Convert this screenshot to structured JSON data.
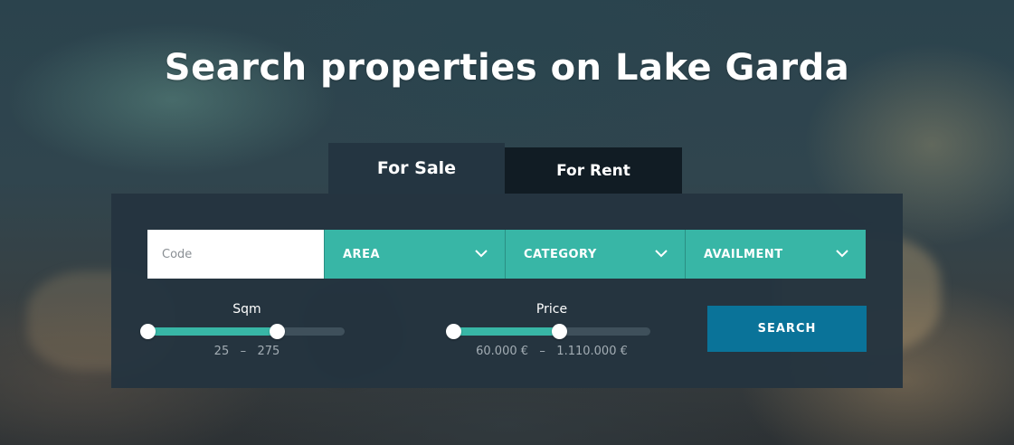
{
  "hero": {
    "title": "Search properties on Lake Garda"
  },
  "tabs": [
    {
      "label": "For Sale",
      "active": true
    },
    {
      "label": "For Rent",
      "active": false
    }
  ],
  "search_form": {
    "code_placeholder": "Code",
    "dropdowns": [
      {
        "label": "AREA"
      },
      {
        "label": "CATEGORY"
      },
      {
        "label": "AVAILMENT"
      }
    ],
    "sqm": {
      "label": "Sqm",
      "min": 25,
      "max": 275,
      "range_text": "25   –   275"
    },
    "price": {
      "label": "Price",
      "min_text": "60.000 €",
      "max_text": "1.110.000 €",
      "range_text": "60.000 €   –   1.110.000 €"
    },
    "search_button": "SEARCH"
  },
  "colors": {
    "accent": "#38b6a6",
    "button": "#0a7399",
    "panel": "#243541",
    "inactive_tab": "#111c24"
  }
}
